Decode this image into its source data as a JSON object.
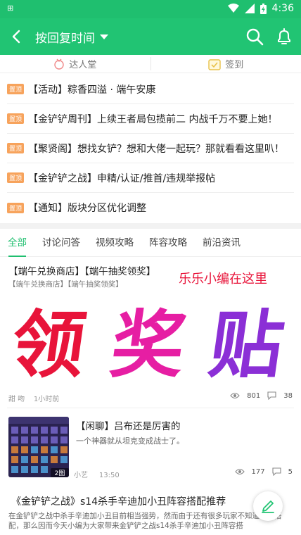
{
  "status": {
    "time": "4:36",
    "sim": "⊞"
  },
  "appbar": {
    "title": "按回复时间"
  },
  "quicknav": [
    {
      "label": "达人堂"
    },
    {
      "label": "签到"
    }
  ],
  "pin_label": "置顶",
  "notices": [
    "【活动】粽香四溢 · 端午安康",
    "【金铲铲周刊】上续王者局包揽前二 内战千万不要上她！",
    "【聚贤阁】想找女铲？想和大佬一起玩？那就看看这里叭！",
    "【金铲铲之战】申精/认证/推首/违规举报帖",
    "【通知】版块分区优化调整"
  ],
  "tabs": [
    "全部",
    "讨论问答",
    "视频攻略",
    "阵容攻略",
    "前沿资讯"
  ],
  "posts": [
    {
      "title": "【端午兑换商店】【端午抽奖领奖】",
      "subtitle": "【端午兑换商店】【端午抽奖领奖】",
      "callout": "乐乐小编在这里",
      "banner": [
        "领",
        "奖",
        "贴"
      ],
      "author": "甜 吻",
      "time": "1小时前",
      "views": "801",
      "comments": "38"
    },
    {
      "title": "【闲聊】吕布还是厉害的",
      "subtitle": "一个神器就从坦克变成战士了。",
      "author": "小艺",
      "time": "13:50",
      "views": "177",
      "comments": "5",
      "badge": "2图"
    },
    {
      "title": "《金铲铲之战》s14杀手辛迪加小丑阵容搭配推荐",
      "subtitle": "在金铲铲之战中杀手辛迪加小丑目前相当强势，然而由于还有很多玩家不知道怎么搭配，那么因而今天小编为大家带来金铲铲之战s14杀手辛迪加小丑阵容搭"
    }
  ],
  "colors": {
    "accent": "#21c473",
    "pin": "#f7a35c",
    "callout": "#e8143a"
  }
}
